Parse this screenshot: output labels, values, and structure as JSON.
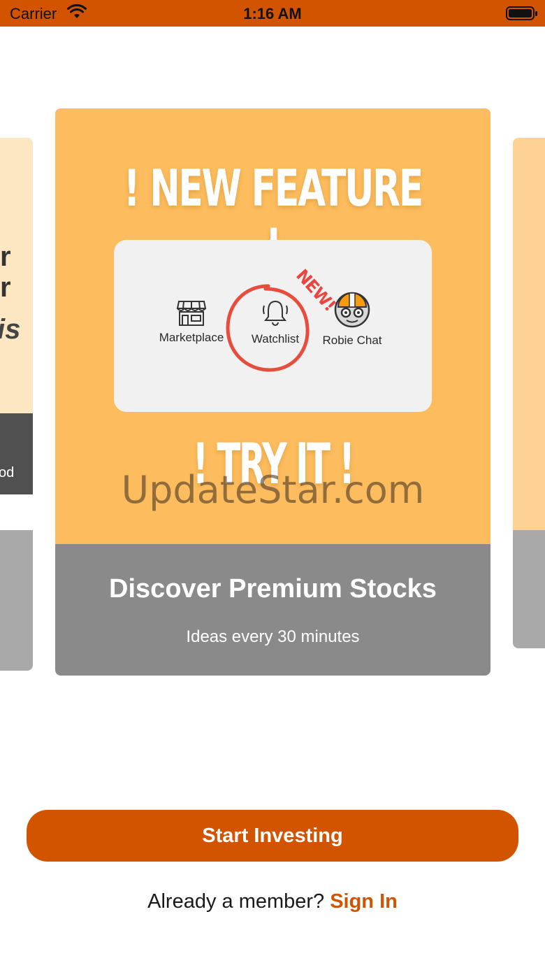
{
  "status_bar": {
    "carrier": "Carrier",
    "time": "1:16 AM",
    "background": "#d35400"
  },
  "peek_left": {
    "fragments": [
      "r",
      "r",
      "is"
    ],
    "dark_fragment": "od"
  },
  "card": {
    "headline": "! NEW FEATURE !",
    "features": [
      {
        "label": "Marketplace",
        "icon": "storefront-icon"
      },
      {
        "label": "Watchlist",
        "icon": "bell-icon"
      },
      {
        "label": "Robie Chat",
        "icon": "robot-icon"
      }
    ],
    "new_stamp": "NEW!",
    "cta": "! TRY IT !",
    "watermark": "UpdateStar.com",
    "title": "Discover Premium Stocks",
    "subtitle": "Ideas every 30 minutes",
    "banner_color": "#fdbd5e",
    "caption_color": "#8a8a8a"
  },
  "actions": {
    "start_label": "Start Investing",
    "member_prompt": "Already a member?",
    "signin_label": "Sign In",
    "accent": "#d35400"
  }
}
